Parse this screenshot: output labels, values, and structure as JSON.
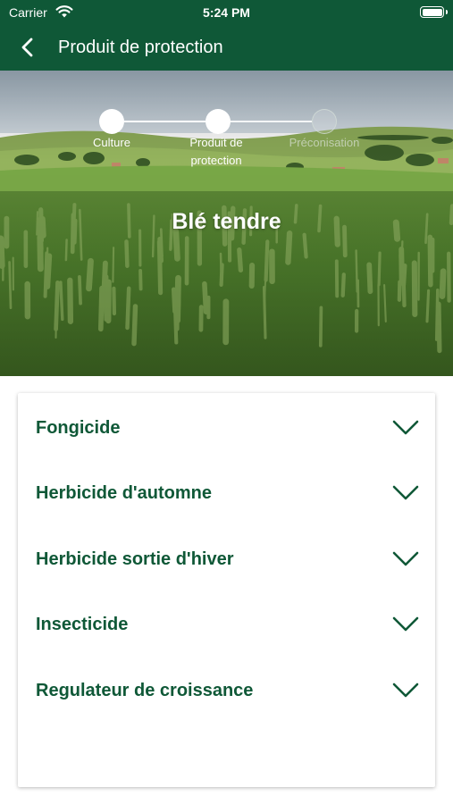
{
  "status_bar": {
    "carrier": "Carrier",
    "time": "5:24 PM",
    "wifi_icon": "wifi-icon",
    "battery_icon": "battery-icon"
  },
  "nav": {
    "title": "Produit de protection",
    "back_icon": "chevron-left-icon"
  },
  "hero": {
    "title": "Blé tendre",
    "steps": [
      {
        "line1": "Culture",
        "line2": "",
        "state": "completed"
      },
      {
        "line1": "Produit de",
        "line2": "protection",
        "state": "current"
      },
      {
        "line1": "Préconisation",
        "line2": "",
        "state": "pending"
      }
    ]
  },
  "accordion": {
    "items": [
      {
        "label": "Fongicide",
        "icon": "chevron-down-icon"
      },
      {
        "label": "Herbicide d'automne",
        "icon": "chevron-down-icon"
      },
      {
        "label": "Herbicide sortie d'hiver",
        "icon": "chevron-down-icon"
      },
      {
        "label": "Insecticide",
        "icon": "chevron-down-icon"
      },
      {
        "label": "Regulateur de croissance",
        "icon": "chevron-down-icon"
      }
    ]
  },
  "colors": {
    "brand_green": "#0f5837",
    "text_white": "#ffffff"
  }
}
